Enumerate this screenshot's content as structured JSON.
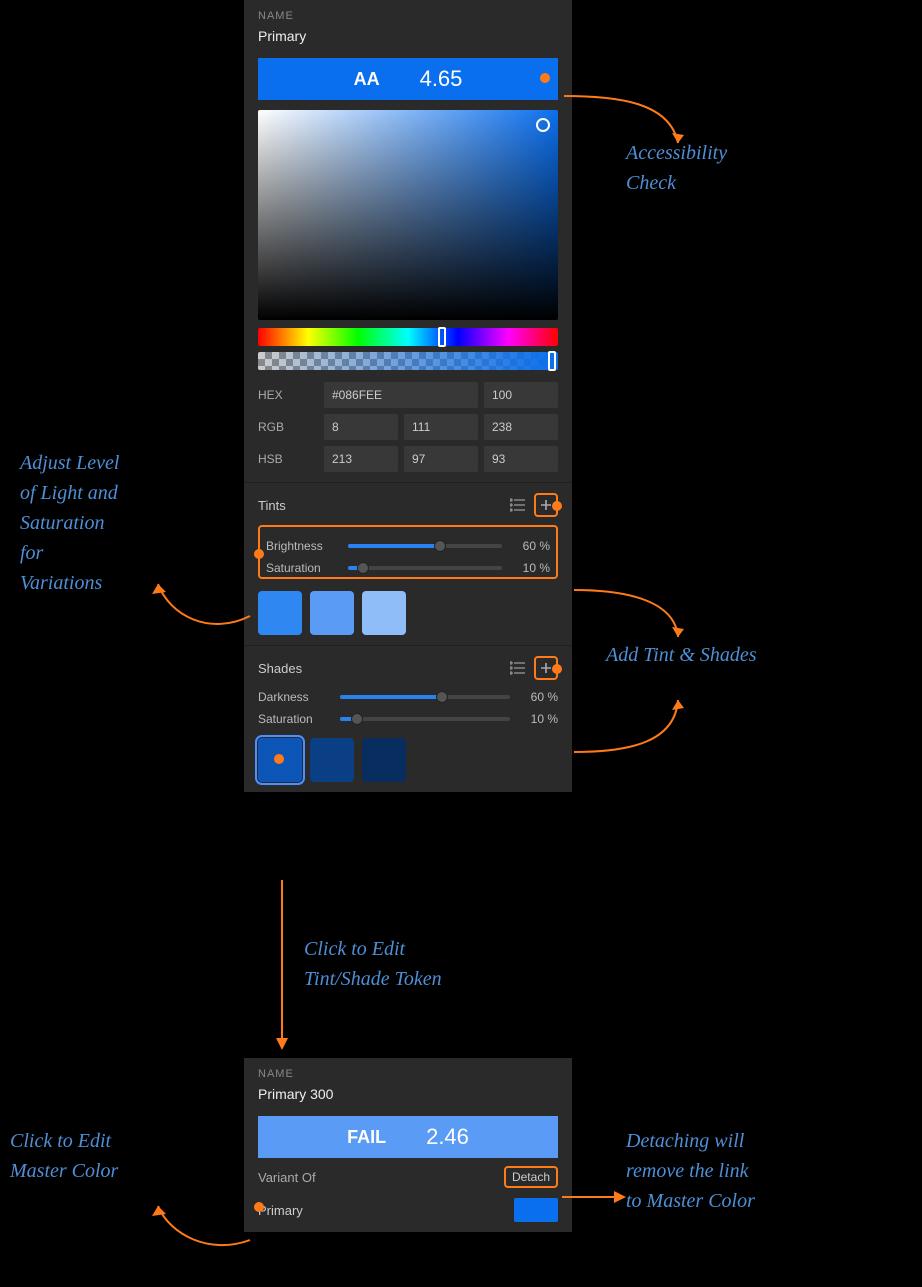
{
  "panel1": {
    "nameLabel": "NAME",
    "nameValue": "Primary",
    "a11y": {
      "rating": "AA",
      "score": "4.65",
      "bg": "#0a6fee"
    },
    "color": {
      "hexLabel": "HEX",
      "hex": "#086FEE",
      "alpha": "100",
      "rgbLabel": "RGB",
      "r": "8",
      "g": "111",
      "b": "238",
      "hsbLabel": "HSB",
      "h": "213",
      "s": "97",
      "v": "93"
    },
    "tints": {
      "title": "Tints",
      "brightnessLabel": "Brightness",
      "brightnessVal": "60 %",
      "brightnessPct": 60,
      "saturationLabel": "Saturation",
      "saturationVal": "10 %",
      "saturationPct": 10,
      "swatches": [
        "#2f87f2",
        "#5a9cf5",
        "#8fbdf8"
      ]
    },
    "shades": {
      "title": "Shades",
      "darknessLabel": "Darkness",
      "darknessVal": "60 %",
      "darknessPct": 60,
      "saturationLabel": "Saturation",
      "saturationVal": "10 %",
      "saturationPct": 10,
      "swatches": [
        "#0d56b8",
        "#0b3f85",
        "#082e5f"
      ],
      "selectedIndex": 0
    }
  },
  "panel2": {
    "nameLabel": "NAME",
    "nameValue": "Primary 300",
    "a11y": {
      "rating": "FAIL",
      "score": "2.46"
    },
    "variantOfLabel": "Variant Of",
    "detachLabel": "Detach",
    "masterName": "Primary",
    "masterColor": "#0a6fee"
  },
  "annotations": {
    "a11y": "Accessibility\nCheck",
    "adjust": "Adjust Level\nof Light and\nSaturation\nfor\nVariations",
    "add": "Add Tint & Shades",
    "clickEditToken": "Click to Edit\nTint/Shade Token",
    "clickMaster": "Click to Edit\nMaster Color",
    "detach": "Detaching will\nremove the link\nto Master Color"
  }
}
